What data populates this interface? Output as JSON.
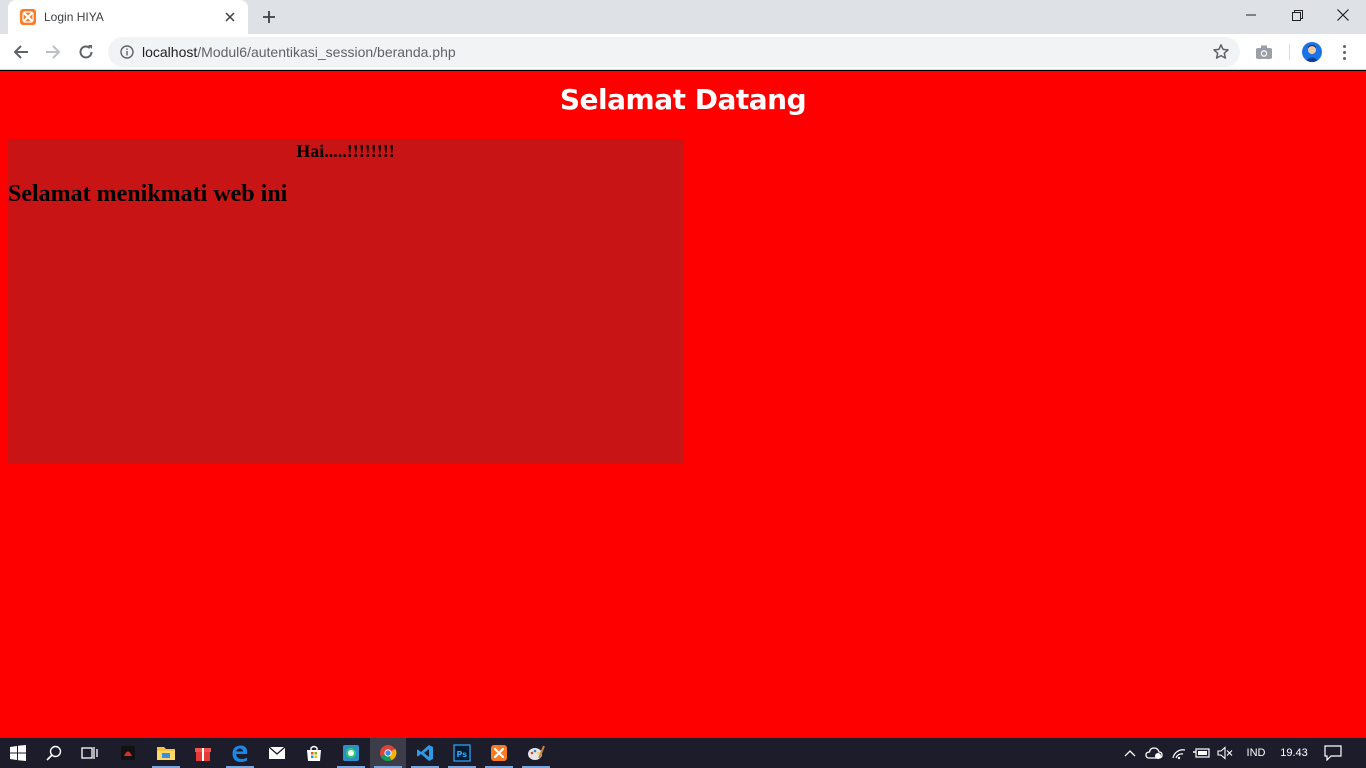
{
  "browser": {
    "tab_title": "Login HIYA",
    "url_host": "localhost",
    "url_path": "/Modul6/autentikasi_session/beranda.php"
  },
  "page": {
    "heading": "Selamat Datang",
    "greeting": "Hai.....!!!!!!!!",
    "welcome": "Selamat menikmati web ini",
    "colors": {
      "background": "#ff0000",
      "box": "#c81414",
      "heading": "#ffffff"
    }
  },
  "taskbar": {
    "apps": [
      "start-icon",
      "search-icon",
      "task-view-icon",
      "game-app-icon",
      "file-explorer-icon",
      "gift-app-icon",
      "edge-icon",
      "mail-icon",
      "store-icon",
      "whatsapp-icon",
      "chrome-icon",
      "vscode-icon",
      "photoshop-icon",
      "xampp-icon",
      "paint-icon"
    ],
    "language": "IND",
    "clock": "19.43"
  }
}
